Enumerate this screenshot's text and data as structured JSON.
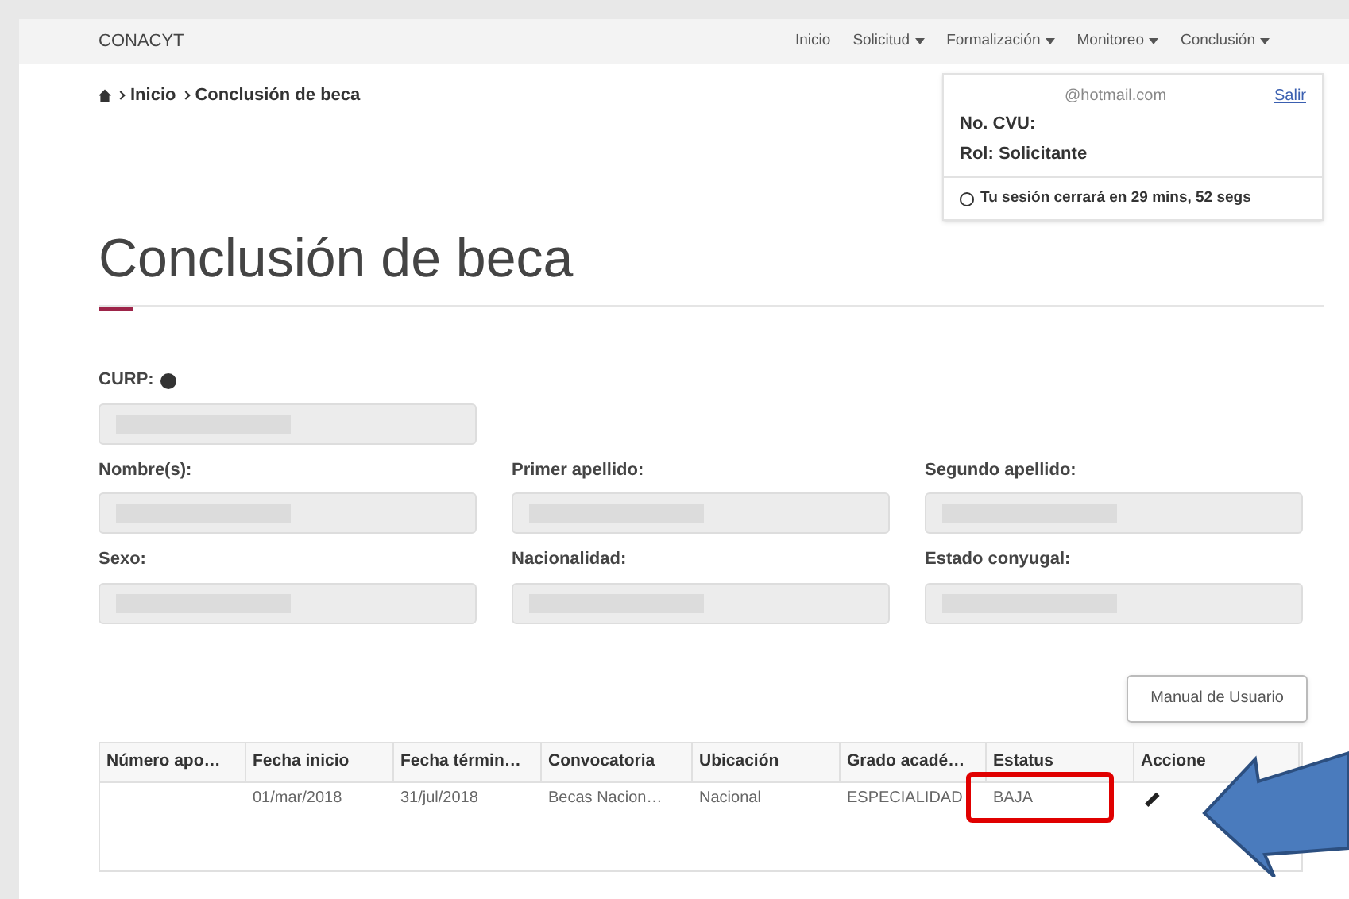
{
  "navbar": {
    "brand": "CONACYT",
    "items": [
      {
        "label": "Inicio",
        "dropdown": false
      },
      {
        "label": "Solicitud",
        "dropdown": true
      },
      {
        "label": "Formalización",
        "dropdown": true
      },
      {
        "label": "Monitoreo",
        "dropdown": true
      },
      {
        "label": "Conclusión",
        "dropdown": true
      }
    ]
  },
  "breadcrumb": [
    "Inicio",
    "Conclusión de beca"
  ],
  "user_panel": {
    "email": "@hotmail.com",
    "logout": "Salir",
    "cvu": "No. CVU:",
    "role": "Rol: Solicitante",
    "session": "Tu sesión cerrará en 29 mins, 52 segs"
  },
  "title": "Conclusión de beca",
  "fields": [
    [
      {
        "label": "CURP:",
        "help": true
      }
    ],
    [
      {
        "label": "Nombre(s):",
        "help": false
      },
      {
        "label": "Primer apellido:",
        "help": false
      },
      {
        "label": "Segundo apellido:",
        "help": false
      }
    ],
    [
      {
        "label": "Sexo:",
        "help": false
      },
      {
        "label": "Nacionalidad:",
        "help": false
      },
      {
        "label": "Estado conyugal:",
        "help": false
      }
    ]
  ],
  "manual_button": "Manual de Usuario",
  "table": {
    "columns": [
      "Número apo…",
      "Fecha inicio",
      "Fecha términ…",
      "Convocatoria",
      "Ubicación",
      "Grado acadé…",
      "Estatus",
      "Accione"
    ],
    "rows": [
      {
        "cells": [
          "",
          "01/mar/2018",
          "31/jul/2018",
          "Becas Nacion…",
          "Nacional",
          "ESPECIALIDAD",
          "BAJA"
        ],
        "editable": true
      }
    ]
  },
  "annotation": {
    "highlight_status": true,
    "arrow_to_action": true
  }
}
